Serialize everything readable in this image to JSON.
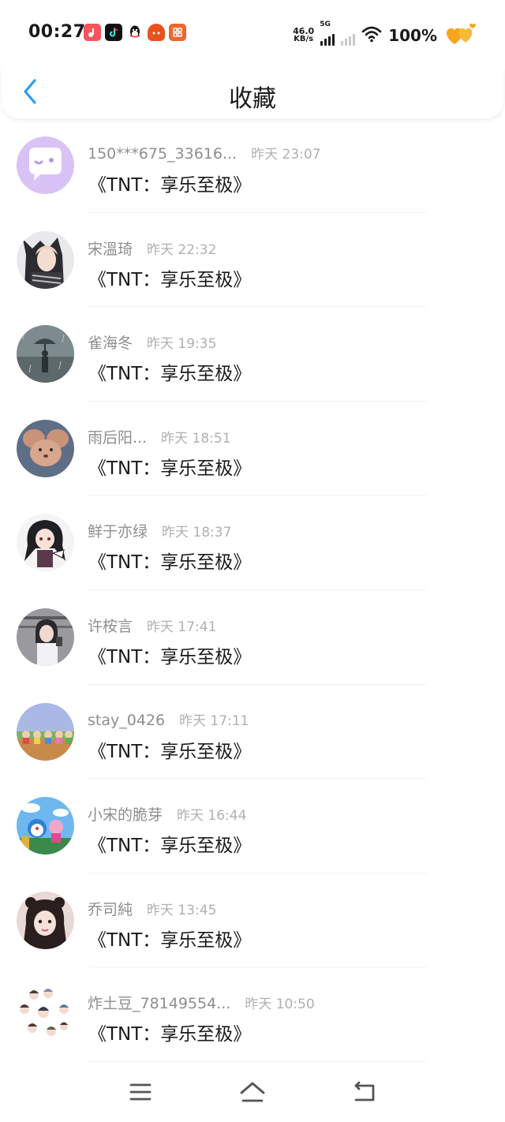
{
  "status_bar": {
    "time": "00:27",
    "app_icons": [
      "music-app-icon",
      "tiktok-icon",
      "qq-icon",
      "game-icon",
      "calendar-app-icon"
    ],
    "net_speed_value": "46.0",
    "net_speed_unit": "KB/s",
    "network_label": "5G",
    "battery": "100%"
  },
  "header": {
    "title": "收藏",
    "back_icon": "chevron-left-icon"
  },
  "list": [
    {
      "username": "150***675_33616...",
      "time": "昨天 23:07",
      "content": "《TNT：享乐至极》"
    },
    {
      "username": "宋溫琦",
      "time": "昨天 22:32",
      "content": "《TNT：享乐至极》"
    },
    {
      "username": "雀海冬",
      "time": "昨天 19:35",
      "content": "《TNT：享乐至极》"
    },
    {
      "username": "雨后阳...",
      "time": "昨天 18:51",
      "content": "《TNT：享乐至极》"
    },
    {
      "username": "鲜于亦绿",
      "time": "昨天 18:37",
      "content": "《TNT：享乐至极》"
    },
    {
      "username": "许桉言",
      "time": "昨天 17:41",
      "content": "《TNT：享乐至极》"
    },
    {
      "username": "stay_0426",
      "time": "昨天 17:11",
      "content": "《TNT：享乐至极》"
    },
    {
      "username": "小宋的脆芽",
      "time": "昨天 16:44",
      "content": "《TNT：享乐至极》"
    },
    {
      "username": "乔司純",
      "time": "昨天 13:45",
      "content": "《TNT：享乐至极》"
    },
    {
      "username": "炸土豆_78149554...",
      "time": "昨天 10:50",
      "content": "《TNT：享乐至极》"
    }
  ],
  "navbar": {
    "icons": [
      "menu-icon",
      "home-icon",
      "back-icon"
    ]
  },
  "colors": {
    "accent": "#2a9df4",
    "username": "#8e8e8e",
    "timestamp": "#b0b0b0",
    "text": "#1a1a1a"
  }
}
